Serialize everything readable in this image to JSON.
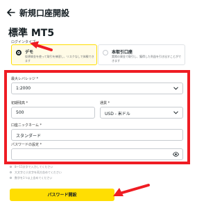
{
  "header": {
    "title": "新規口座開設",
    "back_icon": "arrow-left-icon"
  },
  "product": {
    "title": "標準 MT5"
  },
  "login_type": {
    "label": "ログインタイプ",
    "options": [
      {
        "title": "デモ",
        "desc": "仮想資金を使って取引を練習し、リスクなしで体験できます",
        "selected": true
      },
      {
        "title": "本取引口座",
        "desc": "実際の資金で取引し、獲得した利益を引き出すことができます",
        "selected": false
      }
    ]
  },
  "form": {
    "leverage": {
      "label": "最大レバレッジ *",
      "value": "1:2000"
    },
    "deposit": {
      "label": "初期残高 *",
      "value": "500"
    },
    "currency": {
      "label": "通貨 *",
      "value": "USD - 米ドル"
    },
    "nickname": {
      "label": "口座ニックネーム *",
      "value": "スタンダード"
    },
    "password": {
      "label": "パスワードの設定 *",
      "value": ""
    }
  },
  "hints": [
    "8〜15文字で入力してください",
    "大文字と小文字を両方含めてください",
    "数字を1つ以上含めてください"
  ],
  "submit": {
    "label": "パスワード開設"
  },
  "colors": {
    "accent": "#ffde02",
    "highlight": "#ef1c23",
    "text": "#141d22"
  }
}
